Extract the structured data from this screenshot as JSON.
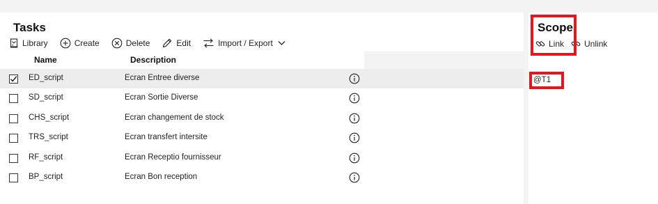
{
  "tasks": {
    "title": "Tasks",
    "toolbar": {
      "library": "Library",
      "create": "Create",
      "delete": "Delete",
      "edit": "Edit",
      "import_export": "Import / Export"
    },
    "columns": {
      "name": "Name",
      "description": "Description"
    },
    "rows": [
      {
        "name": "ED_script",
        "description": "Ecran Entree diverse",
        "checked": true
      },
      {
        "name": "SD_script",
        "description": "Ecran Sortie Diverse",
        "checked": false
      },
      {
        "name": "CHS_script",
        "description": "Ecran changement de stock",
        "checked": false
      },
      {
        "name": "TRS_script",
        "description": "Ecran transfert intersite",
        "checked": false
      },
      {
        "name": "RF_script",
        "description": "Ecran Receptio fournisseur",
        "checked": false
      },
      {
        "name": "BP_script",
        "description": "Ecran Bon reception",
        "checked": false
      }
    ]
  },
  "scope": {
    "title": "Scope",
    "toolbar": {
      "link": "Link",
      "unlink": "Unlink"
    },
    "items": [
      "@T1"
    ],
    "highlight_color": "#e8141e"
  },
  "icons": [
    "library-icon",
    "plus-circle-icon",
    "x-circle-icon",
    "pencil-icon",
    "import-export-icon",
    "chevron-down-icon",
    "info-icon",
    "checkmark-icon",
    "link-icon",
    "unlink-icon"
  ]
}
